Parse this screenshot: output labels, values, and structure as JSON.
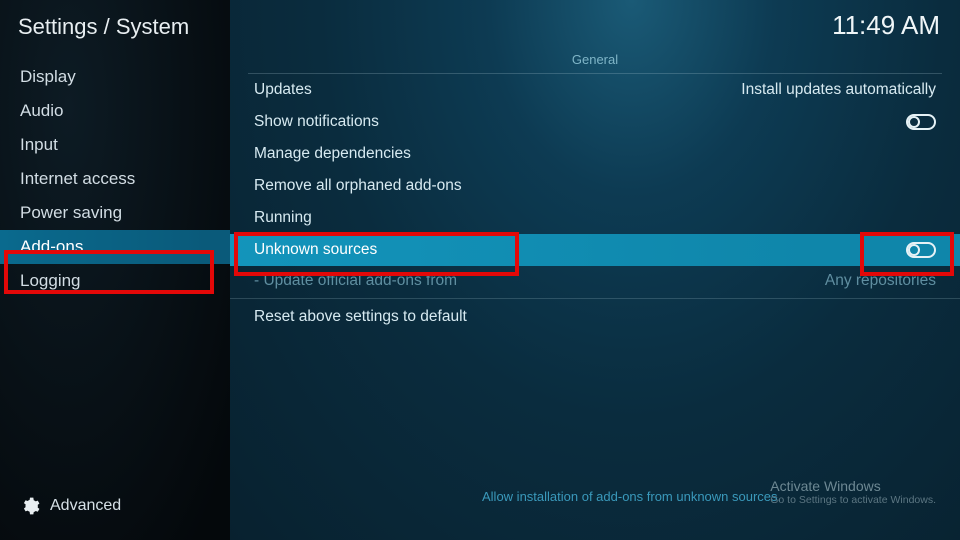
{
  "header": {
    "breadcrumb": "Settings / System",
    "clock": "11:49 AM"
  },
  "sidebar": {
    "items": [
      {
        "label": "Display"
      },
      {
        "label": "Audio"
      },
      {
        "label": "Input"
      },
      {
        "label": "Internet access"
      },
      {
        "label": "Power saving"
      },
      {
        "label": "Add-ons"
      },
      {
        "label": "Logging"
      }
    ],
    "active_index": 5,
    "level_label": "Advanced"
  },
  "section": {
    "title": "General",
    "rows": [
      {
        "label": "Updates",
        "value": "Install updates automatically"
      },
      {
        "label": "Show notifications",
        "toggle": true,
        "toggle_on": false
      },
      {
        "label": "Manage dependencies"
      },
      {
        "label": "Remove all orphaned add-ons"
      },
      {
        "label": "Running"
      },
      {
        "label": "Unknown sources",
        "toggle": true,
        "toggle_on": false
      },
      {
        "label": "- Update official add-ons from",
        "value": "Any repositories"
      },
      {
        "label": "Reset above settings to default"
      }
    ],
    "selected_index": 5,
    "disabled_index": 6,
    "hint": "Allow installation of add-ons from unknown sources."
  },
  "watermark": {
    "line1": "Activate Windows",
    "line2": "Go to Settings to activate Windows."
  },
  "highlights": {
    "sidebar_item_index": 5,
    "row_label_index": 5,
    "row_toggle_index": 5
  }
}
